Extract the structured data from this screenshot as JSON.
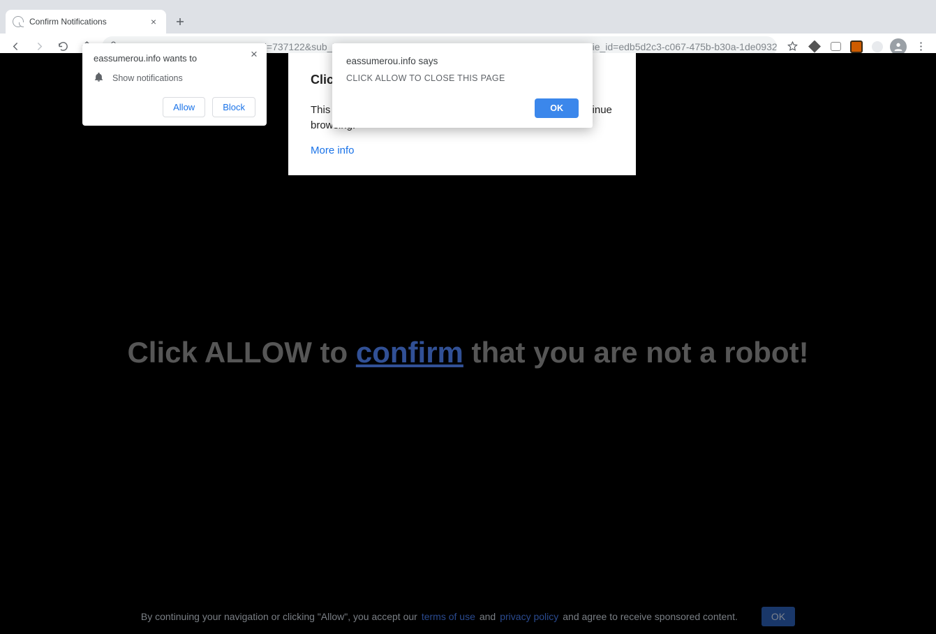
{
  "window": {
    "tab_title": "Confirm Notifications"
  },
  "address": {
    "host": "eassumerou.info",
    "path": "/QZIXO?tag_id=737122&sub_id1=pdsk_1365143&sub_id2=7645077551903097245&cookie_id=edb5d2c3-c067-475b-b30a-1de0932e614d&lp=oct_42&convert=You..."
  },
  "perm_prompt": {
    "title": "eassumerou.info wants to",
    "line": "Show notifications",
    "allow": "Allow",
    "block": "Block"
  },
  "alert": {
    "title": "eassumerou.info says",
    "message": "CLICK ALLOW TO CLOSE THIS PAGE",
    "ok": "OK"
  },
  "card": {
    "heading": "Click Allow",
    "body_a": "This website wants to show you notifications so you can continue",
    "body_b": "browsing.",
    "more": "More info"
  },
  "page_main": {
    "part1": "Click ALLOW to ",
    "confirm": "confirm",
    "part2": " that you are not a robot!"
  },
  "consent": {
    "pre": "By continuing your navigation or clicking \"Allow\", you accept our ",
    "terms": "terms of use",
    "and": " and ",
    "privacy": "privacy policy",
    "post": " and agree to receive sponsored content.",
    "ok": "OK"
  }
}
